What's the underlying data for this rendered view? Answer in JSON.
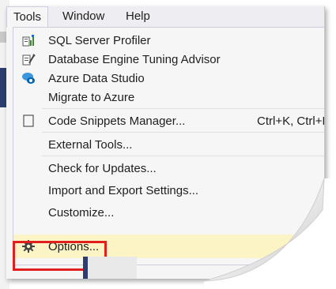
{
  "menubar": {
    "tools": "Tools",
    "window": "Window",
    "help": "Help"
  },
  "menu": {
    "items": [
      {
        "label": "SQL Server Profiler",
        "icon": "profiler-icon"
      },
      {
        "label": "Database Engine Tuning Advisor",
        "icon": "tuning-advisor-icon"
      },
      {
        "label": "Azure Data Studio",
        "icon": "azure-data-studio-icon"
      },
      {
        "label": "Migrate to Azure"
      },
      {
        "label": "Code Snippets Manager...",
        "icon": "snippets-icon",
        "shortcut": "Ctrl+K, Ctrl+B"
      },
      {
        "label": "External Tools..."
      },
      {
        "label": "Check for Updates..."
      },
      {
        "label": "Import and Export Settings..."
      },
      {
        "label": "Customize..."
      },
      {
        "label": "Options...",
        "icon": "gear-icon"
      }
    ]
  },
  "colors": {
    "highlight_border": "#e0201c",
    "hover_bg": "#fcf4c5"
  }
}
